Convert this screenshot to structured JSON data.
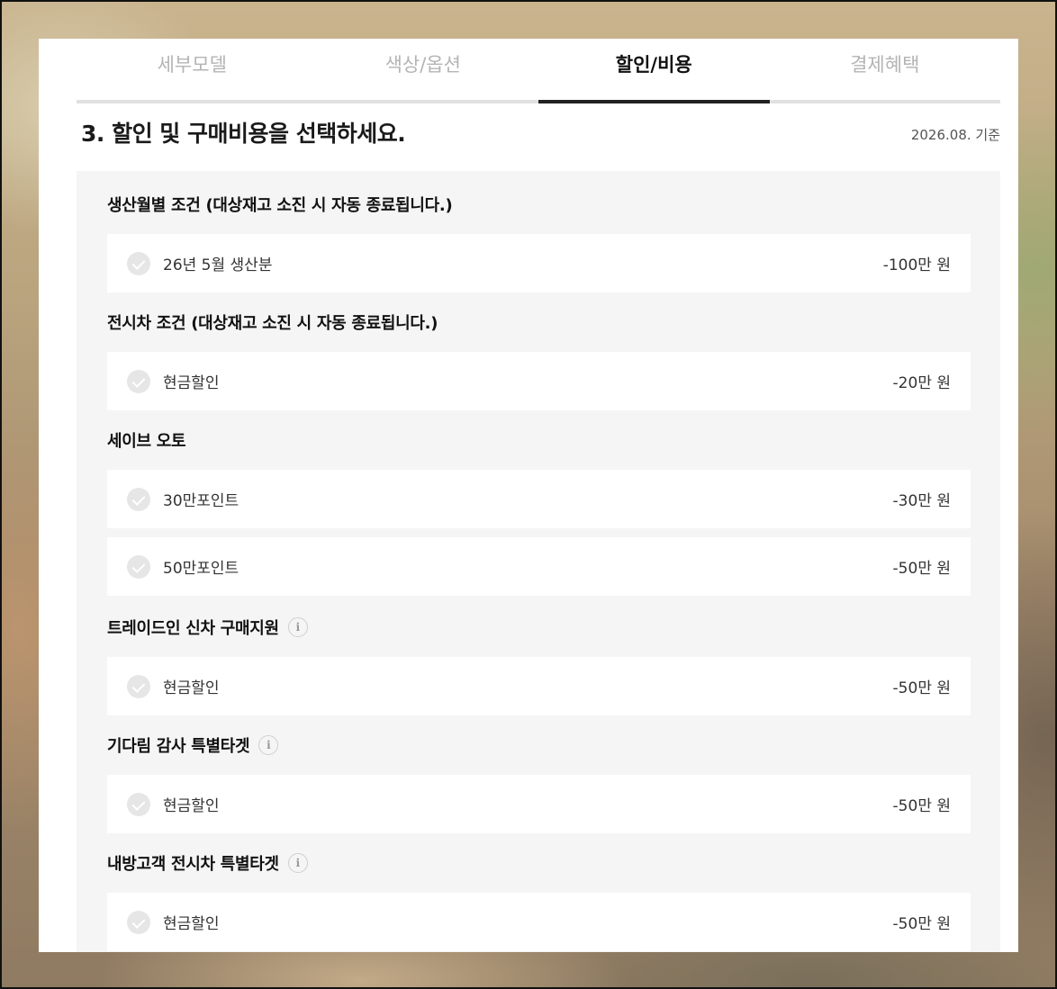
{
  "tabs": [
    {
      "label": "세부모델"
    },
    {
      "label": "색상/옵션"
    },
    {
      "label": "할인/비용"
    },
    {
      "label": "결제혜택"
    }
  ],
  "active_tab_index": 2,
  "step_title": "3. 할인 및 구매비용을 선택하세요.",
  "basis_date": "2026.08. 기준",
  "groups": [
    {
      "title": "생산월별 조건 (대상재고 소진 시 자동 종료됩니다.)",
      "options": [
        {
          "label": "26년 5월 생산분",
          "amount": "-100만 원"
        }
      ]
    },
    {
      "title": "전시차 조건 (대상재고 소진 시 자동 종료됩니다.)",
      "options": [
        {
          "label": "현금할인",
          "amount": "-20만 원"
        }
      ]
    },
    {
      "title": "세이브 오토",
      "options": [
        {
          "label": "30만포인트",
          "amount": "-30만 원"
        },
        {
          "label": "50만포인트",
          "amount": "-50만 원"
        }
      ]
    },
    {
      "title": "트레이드인 신차 구매지원",
      "info_icon": "info-icon",
      "options": [
        {
          "label": "현금할인",
          "amount": "-50만 원"
        }
      ]
    },
    {
      "title": "기다림 감사 특별타겟",
      "info_icon": "info-icon",
      "options": [
        {
          "label": "현금할인",
          "amount": "-50만 원"
        }
      ]
    },
    {
      "title": "내방고객 전시차 특별타겟",
      "info_icon": "info-icon",
      "options": [
        {
          "label": "현금할인",
          "amount": "-50만 원"
        }
      ]
    }
  ],
  "info_icon_glyph": "i",
  "colors": {
    "active_tab_underline": "#222222",
    "inactive_tab_text": "#b4b4b4",
    "section_background": "#f5f5f5",
    "check_circle": "#e6e6e6"
  }
}
